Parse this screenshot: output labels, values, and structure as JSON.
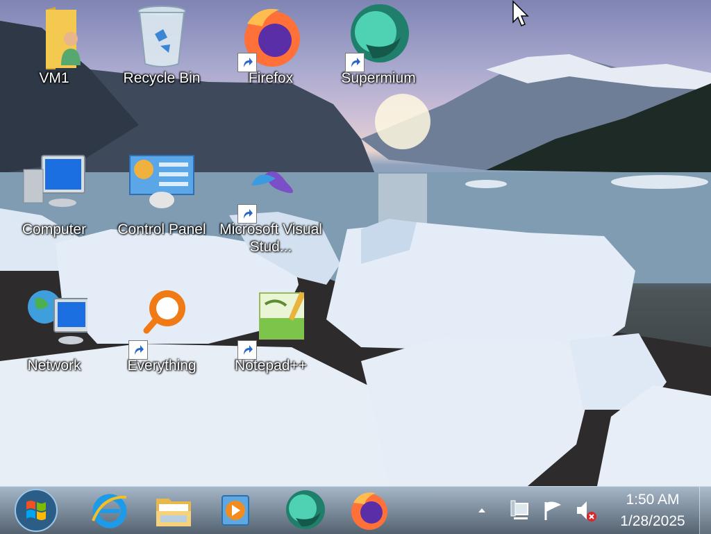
{
  "desktop": {
    "icons": [
      {
        "label": "VM1",
        "icon": "user-folder-icon",
        "shortcut": false
      },
      {
        "label": "Recycle Bin",
        "icon": "recycle-bin-icon",
        "shortcut": false
      },
      {
        "label": "Firefox",
        "icon": "firefox-icon",
        "shortcut": true
      },
      {
        "label": "Supermium",
        "icon": "supermium-icon",
        "shortcut": true
      },
      {
        "label": "Computer",
        "icon": "computer-icon",
        "shortcut": false
      },
      {
        "label": "Control Panel",
        "icon": "control-panel-icon",
        "shortcut": false
      },
      {
        "label": "Microsoft Visual Stud...",
        "icon": "visual-studio-icon",
        "shortcut": true
      },
      {
        "label": "Network",
        "icon": "network-icon",
        "shortcut": false
      },
      {
        "label": "Everything",
        "icon": "everything-search-icon",
        "shortcut": true
      },
      {
        "label": "Notepad++",
        "icon": "notepad-plus-plus-icon",
        "shortcut": true
      }
    ]
  },
  "taskbar": {
    "start_button": "windows-start-orb-icon",
    "pinned": [
      {
        "icon": "internet-explorer-icon"
      },
      {
        "icon": "file-explorer-icon"
      },
      {
        "icon": "media-player-icon"
      },
      {
        "icon": "supermium-icon"
      },
      {
        "icon": "firefox-icon"
      }
    ],
    "tray": {
      "icons": [
        "show-hidden-icons-arrow-icon",
        "network-status-icon",
        "action-center-flag-icon",
        "volume-muted-icon"
      ],
      "time": "1:50 AM",
      "date": "1/28/2025"
    }
  },
  "colors": {
    "firefox_orange": "#ff7139",
    "firefox_purple": "#5a2ea6",
    "supermium_teal": "#2fb69a",
    "taskbar": "#5f7388"
  }
}
